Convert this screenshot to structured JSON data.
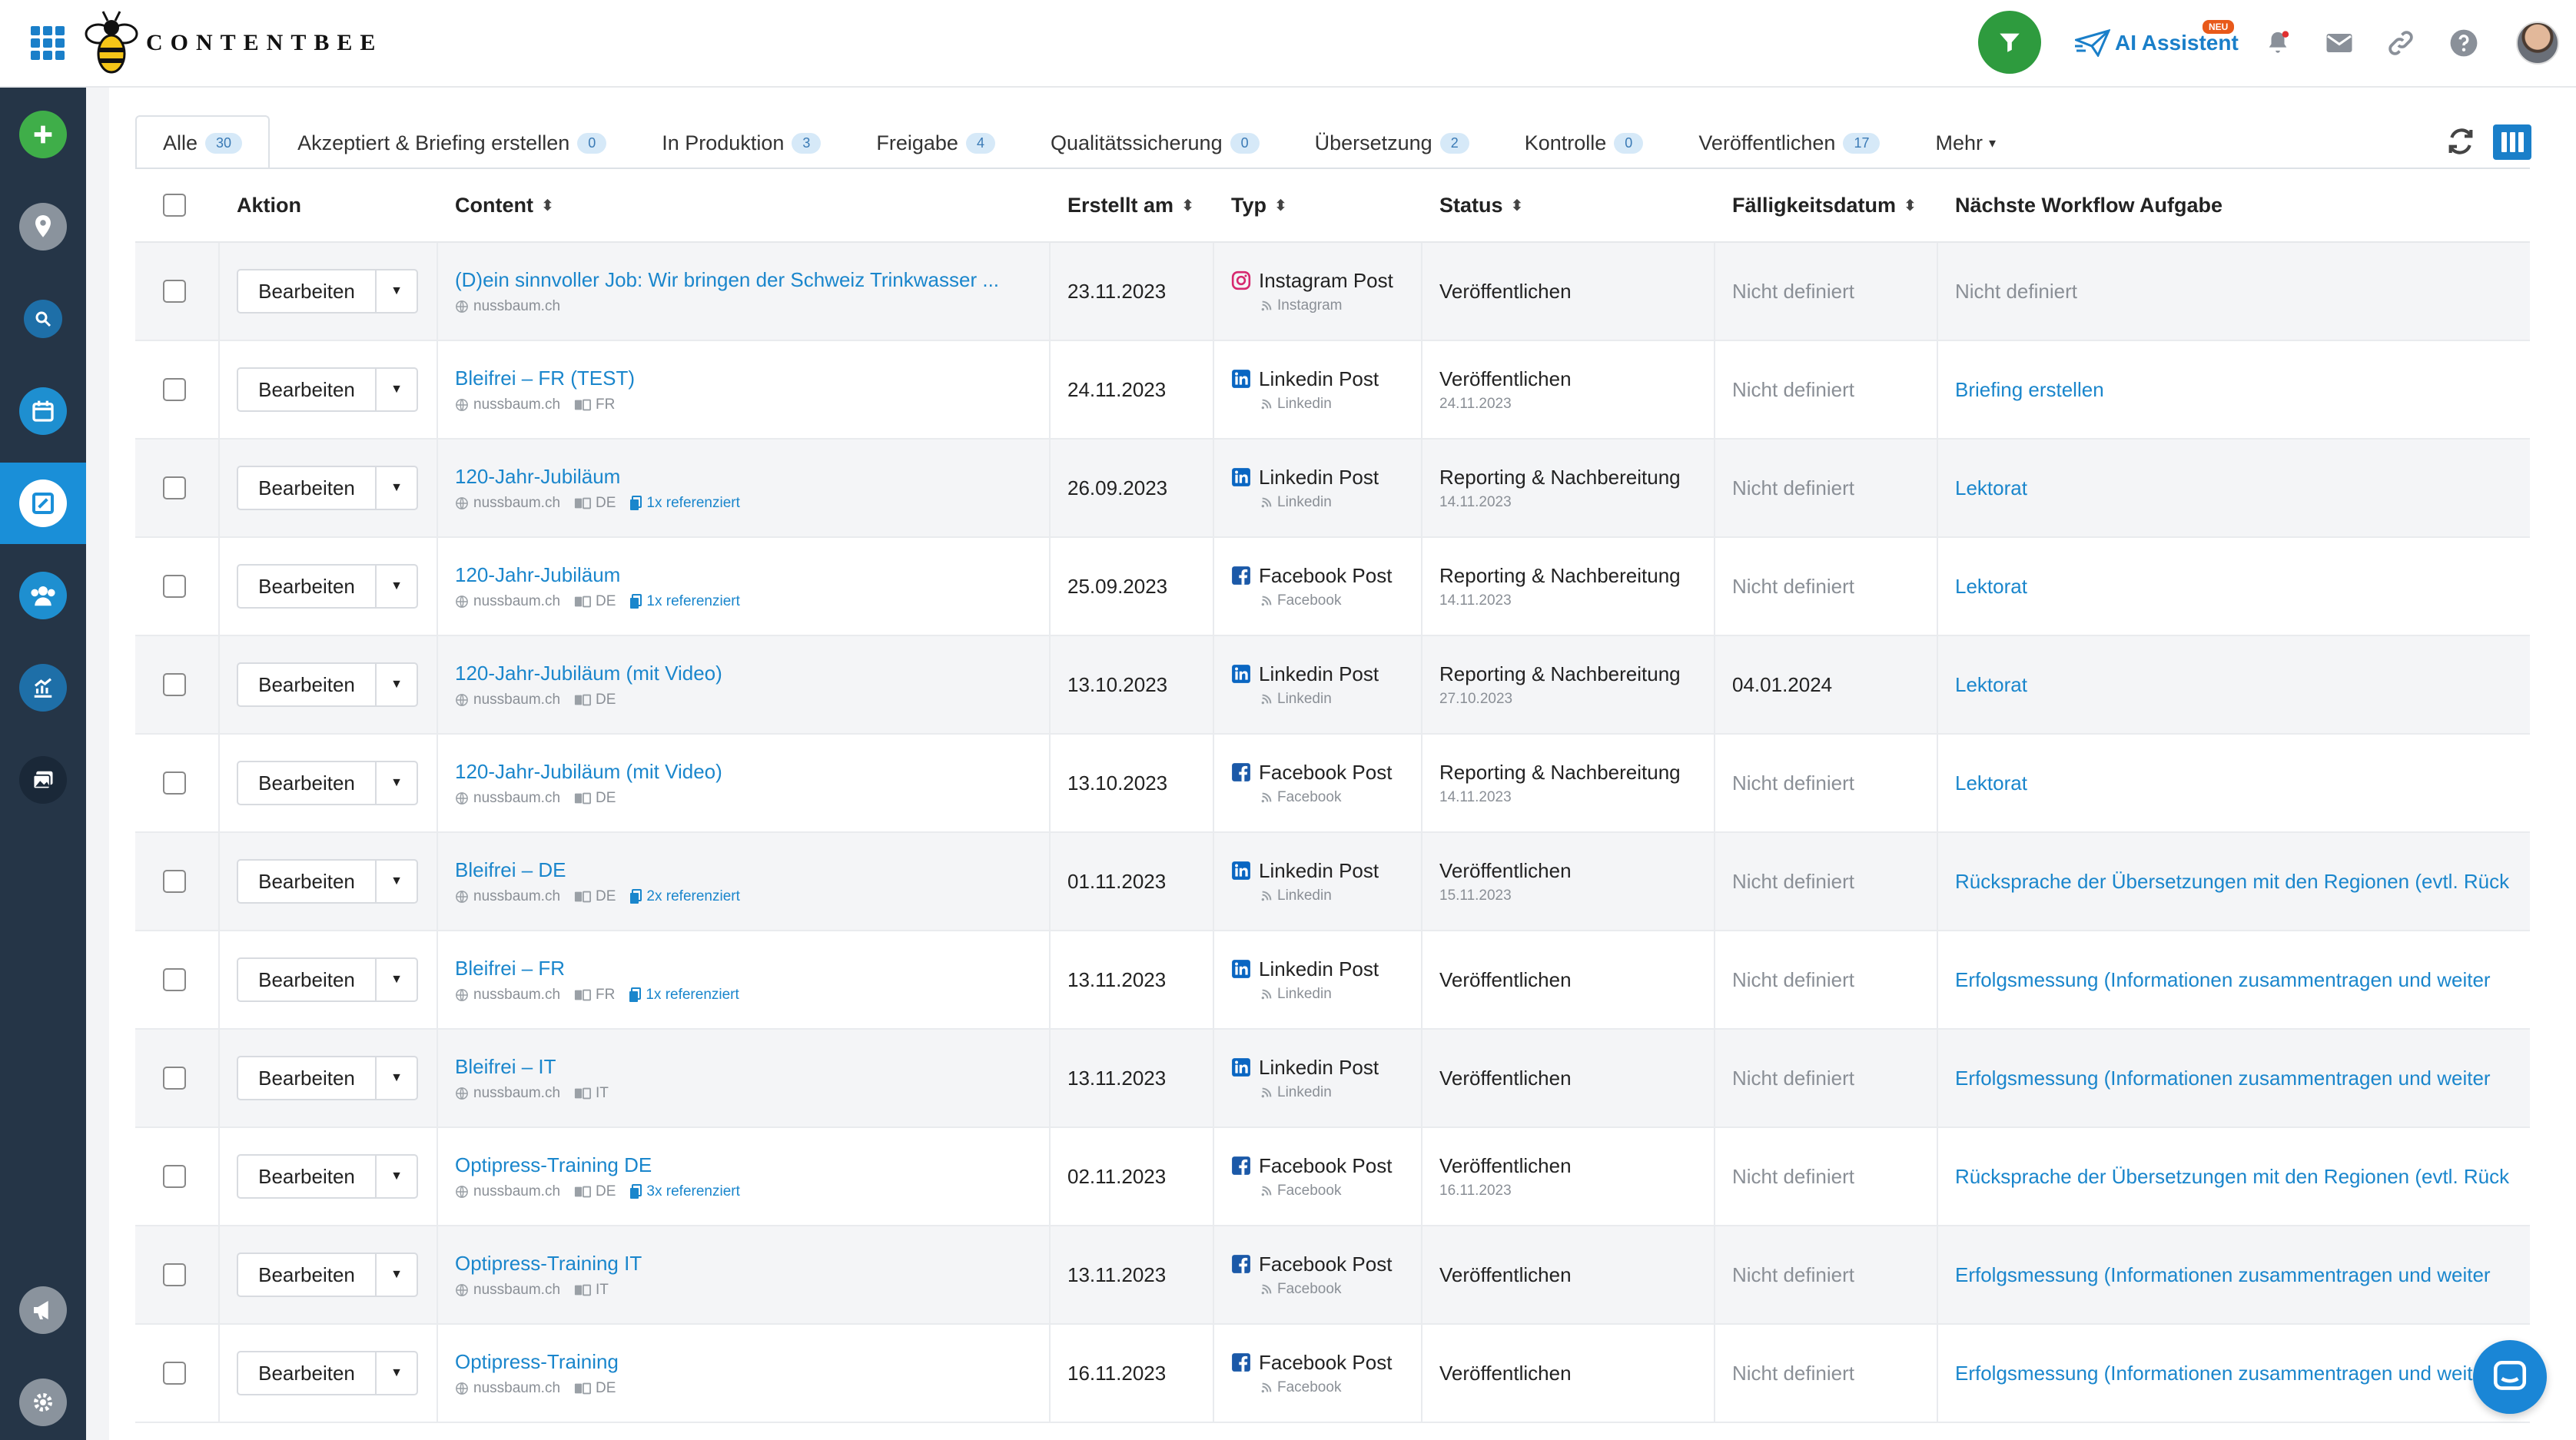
{
  "app": {
    "logo_text": "CONTENTBEE"
  },
  "header": {
    "ai_assistant_label": "AI Assistent",
    "ai_badge": "NEU"
  },
  "tabs": [
    {
      "label": "Alle",
      "count": "30",
      "active": true
    },
    {
      "label": "Akzeptiert & Briefing erstellen",
      "count": "0"
    },
    {
      "label": "In Produktion",
      "count": "3"
    },
    {
      "label": "Freigabe",
      "count": "4"
    },
    {
      "label": "Qualitätssicherung",
      "count": "0"
    },
    {
      "label": "Übersetzung",
      "count": "2"
    },
    {
      "label": "Kontrolle",
      "count": "0"
    },
    {
      "label": "Veröffentlichen",
      "count": "17"
    },
    {
      "label": "Mehr",
      "count": null
    }
  ],
  "columns": {
    "action": "Aktion",
    "content": "Content",
    "created": "Erstellt am",
    "type": "Typ",
    "status": "Status",
    "due": "Fälligkeitsdatum",
    "next": "Nächste Workflow Aufgabe"
  },
  "edit_label": "Bearbeiten",
  "rows": [
    {
      "title": "(D)ein sinnvoller Job: Wir bringen der Schweiz Trinkwasser ...",
      "domain": "nussbaum.ch",
      "lang": "",
      "ref": "",
      "created": "23.11.2023",
      "type": "Instagram Post",
      "network": "Instagram",
      "icon": "instagram-icon",
      "status": "Veröffentlichen",
      "status_date": "",
      "due": "Nicht definiert",
      "next": "Nicht definiert"
    },
    {
      "title": "Bleifrei – FR (TEST)",
      "domain": "nussbaum.ch",
      "lang": "FR",
      "ref": "",
      "created": "24.11.2023",
      "type": "Linkedin Post",
      "network": "Linkedin",
      "icon": "linkedin-icon",
      "status": "Veröffentlichen",
      "status_date": "24.11.2023",
      "due": "Nicht definiert",
      "next": "Briefing erstellen"
    },
    {
      "title": "120-Jahr-Jubiläum",
      "domain": "nussbaum.ch",
      "lang": "DE",
      "ref": "1x referenziert",
      "created": "26.09.2023",
      "type": "Linkedin Post",
      "network": "Linkedin",
      "icon": "linkedin-icon",
      "status": "Reporting & Nachbereitung",
      "status_date": "14.11.2023",
      "due": "Nicht definiert",
      "next": "Lektorat"
    },
    {
      "title": "120-Jahr-Jubiläum",
      "domain": "nussbaum.ch",
      "lang": "DE",
      "ref": "1x referenziert",
      "created": "25.09.2023",
      "type": "Facebook Post",
      "network": "Facebook",
      "icon": "facebook-icon",
      "status": "Reporting & Nachbereitung",
      "status_date": "14.11.2023",
      "due": "Nicht definiert",
      "next": "Lektorat"
    },
    {
      "title": "120-Jahr-Jubiläum (mit Video)",
      "domain": "nussbaum.ch",
      "lang": "DE",
      "ref": "",
      "created": "13.10.2023",
      "type": "Linkedin Post",
      "network": "Linkedin",
      "icon": "linkedin-icon",
      "status": "Reporting & Nachbereitung",
      "status_date": "27.10.2023",
      "due": "04.01.2024",
      "next": "Lektorat"
    },
    {
      "title": "120-Jahr-Jubiläum (mit Video)",
      "domain": "nussbaum.ch",
      "lang": "DE",
      "ref": "",
      "created": "13.10.2023",
      "type": "Facebook Post",
      "network": "Facebook",
      "icon": "facebook-icon",
      "status": "Reporting & Nachbereitung",
      "status_date": "14.11.2023",
      "due": "Nicht definiert",
      "next": "Lektorat"
    },
    {
      "title": "Bleifrei – DE",
      "domain": "nussbaum.ch",
      "lang": "DE",
      "ref": "2x referenziert",
      "created": "01.11.2023",
      "type": "Linkedin Post",
      "network": "Linkedin",
      "icon": "linkedin-icon",
      "status": "Veröffentlichen",
      "status_date": "15.11.2023",
      "due": "Nicht definiert",
      "next": "Rücksprache der Übersetzungen mit den Regionen (evtl. Rück"
    },
    {
      "title": "Bleifrei – FR",
      "domain": "nussbaum.ch",
      "lang": "FR",
      "ref": "1x referenziert",
      "created": "13.11.2023",
      "type": "Linkedin Post",
      "network": "Linkedin",
      "icon": "linkedin-icon",
      "status": "Veröffentlichen",
      "status_date": "",
      "due": "Nicht definiert",
      "next": "Erfolgsmessung (Informationen zusammentragen und weiter"
    },
    {
      "title": "Bleifrei – IT",
      "domain": "nussbaum.ch",
      "lang": "IT",
      "ref": "",
      "created": "13.11.2023",
      "type": "Linkedin Post",
      "network": "Linkedin",
      "icon": "linkedin-icon",
      "status": "Veröffentlichen",
      "status_date": "",
      "due": "Nicht definiert",
      "next": "Erfolgsmessung (Informationen zusammentragen und weiter"
    },
    {
      "title": "Optipress-Training DE",
      "domain": "nussbaum.ch",
      "lang": "DE",
      "ref": "3x referenziert",
      "created": "02.11.2023",
      "type": "Facebook Post",
      "network": "Facebook",
      "icon": "facebook-icon",
      "status": "Veröffentlichen",
      "status_date": "16.11.2023",
      "due": "Nicht definiert",
      "next": "Rücksprache der Übersetzungen mit den Regionen (evtl. Rück"
    },
    {
      "title": "Optipress-Training IT",
      "domain": "nussbaum.ch",
      "lang": "IT",
      "ref": "",
      "created": "13.11.2023",
      "type": "Facebook Post",
      "network": "Facebook",
      "icon": "facebook-icon",
      "status": "Veröffentlichen",
      "status_date": "",
      "due": "Nicht definiert",
      "next": "Erfolgsmessung (Informationen zusammentragen und weiter"
    },
    {
      "title": "Optipress-Training",
      "domain": "nussbaum.ch",
      "lang": "DE",
      "ref": "",
      "created": "16.11.2023",
      "type": "Facebook Post",
      "network": "Facebook",
      "icon": "facebook-icon",
      "status": "Veröffentlichen",
      "status_date": "",
      "due": "Nicht definiert",
      "next": "Erfolgsmessung (Informationen zusammentragen und weiter"
    }
  ],
  "colors": {
    "accent": "#1a86cc",
    "sidebar": "#253547",
    "active": "#1a8fd8",
    "green": "#2e9b3e"
  }
}
